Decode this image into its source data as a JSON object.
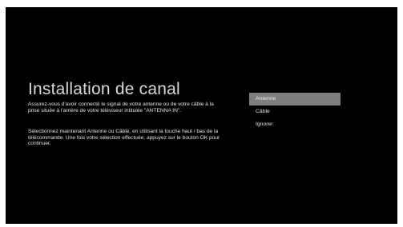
{
  "screen": {
    "title": "Installation de canal",
    "paragraph1": "Assurez-vous d'avoir connecté le signal de votre antenne ou de votre câble à la prise située à l'arrière de votre téléviseur intitulée \"ANTENNA IN\".",
    "paragraph2": "Sélectionnez maintenant Antenne ou Câble, en utilisant la touche haut / bas de la télécommande. Une fois votre sélection effectuée, appuyez sur le bouton OK pour continuer."
  },
  "menu": {
    "items": [
      {
        "label": "Antenne",
        "selected": true
      },
      {
        "label": "Câble",
        "selected": false
      },
      {
        "label": "Ignorer",
        "selected": false
      }
    ]
  },
  "colors": {
    "background": "#000000",
    "highlight": "#7e7e7e",
    "text": "#e4e4e4"
  }
}
